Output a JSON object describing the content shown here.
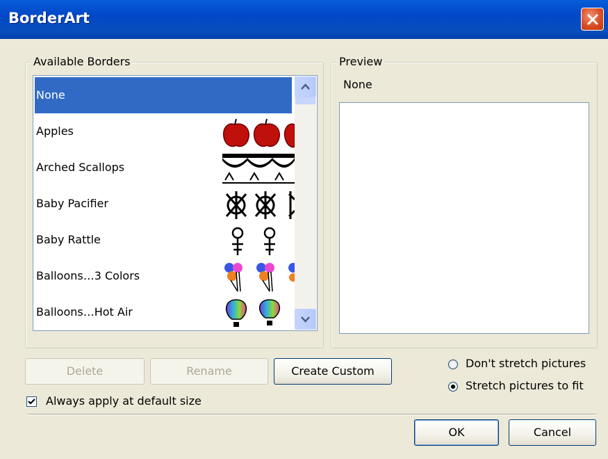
{
  "window": {
    "title": "BorderArt"
  },
  "available_borders": {
    "label": "Available Borders",
    "label_access_char": "v",
    "items": [
      {
        "label": "None",
        "selected": true,
        "art": ""
      },
      {
        "label": "Apples",
        "selected": false,
        "art": "apples"
      },
      {
        "label": "Arched Scallops",
        "selected": false,
        "art": "arched-scallops"
      },
      {
        "label": "Baby Pacifier",
        "selected": false,
        "art": "baby-pacifier"
      },
      {
        "label": "Baby Rattle",
        "selected": false,
        "art": "baby-rattle"
      },
      {
        "label": "Balloons…3 Colors",
        "selected": false,
        "art": "balloons-3-colors"
      },
      {
        "label": "Balloons…Hot Air",
        "selected": false,
        "art": "balloons-hot-air"
      }
    ]
  },
  "preview": {
    "label": "Preview",
    "name": "None"
  },
  "buttons": {
    "delete": "Delete",
    "rename": "Rename",
    "create_custom": "Create Custom",
    "ok": "OK",
    "cancel": "Cancel"
  },
  "stretch_options": {
    "options": [
      {
        "label": "Don't stretch pictures",
        "checked": false
      },
      {
        "label": "Stretch pictures to fit",
        "checked": true
      }
    ]
  },
  "always_apply": {
    "label": "Always apply at default size",
    "checked": true
  },
  "colors": {
    "title_bar": "#0a5cd8",
    "selection": "#316ac5",
    "dialog_bg": "#ece9d8",
    "close_button": "#d8491c"
  }
}
